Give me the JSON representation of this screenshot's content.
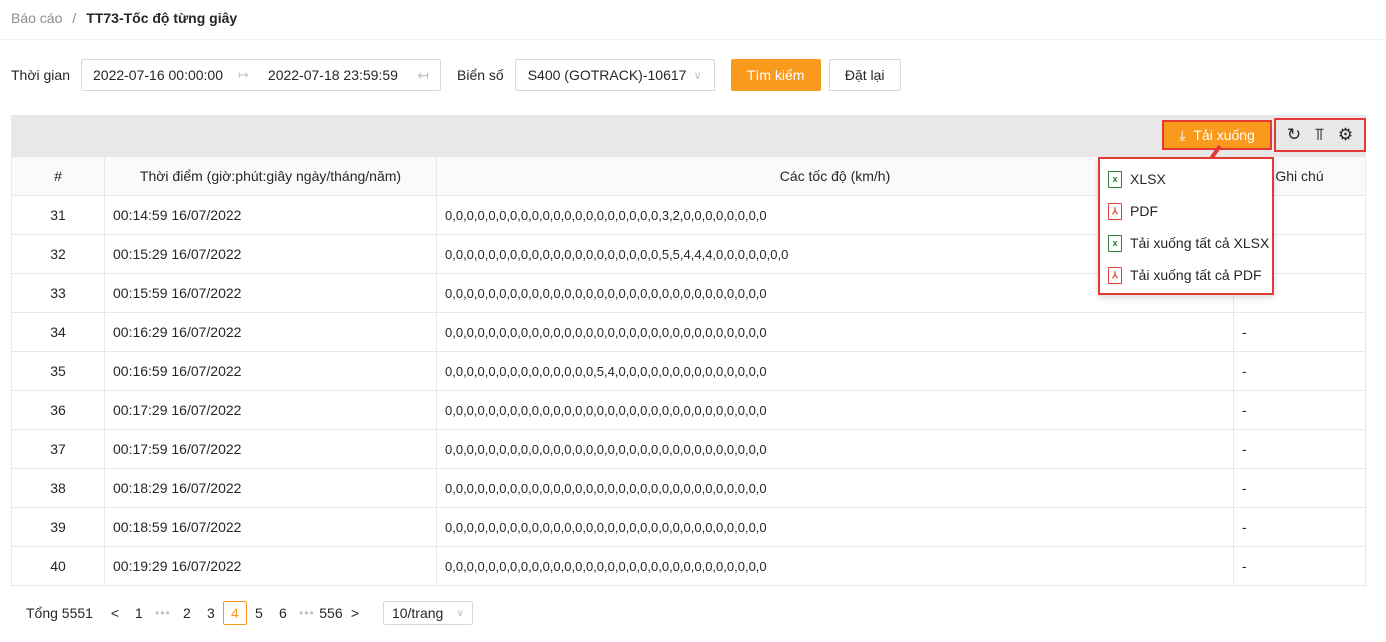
{
  "breadcrumb": {
    "parent": "Báo cáo",
    "separator": "/",
    "current": "TT73-Tốc độ từng giây"
  },
  "filters": {
    "time_label": "Thời gian",
    "start": "2022-07-16 00:00:00",
    "end": "2022-07-18 23:59:59",
    "plate_label": "Biển số",
    "plate_value": "S400 (GOTRACK)-10617",
    "search_label": "Tìm kiếm",
    "reset_label": "Đặt lại"
  },
  "toolbar": {
    "download_label": "Tải xuống"
  },
  "dropdown": {
    "items": [
      {
        "label": "XLSX",
        "type": "xlsx"
      },
      {
        "label": "PDF",
        "type": "pdf"
      },
      {
        "label": "Tải xuống tất cả XLSX",
        "type": "xlsx"
      },
      {
        "label": "Tải xuống tất cả PDF",
        "type": "pdf"
      }
    ]
  },
  "table": {
    "headers": [
      "#",
      "Thời điểm (giờ:phút:giây ngày/tháng/năm)",
      "Các tốc độ (km/h)",
      "Ghi chú"
    ],
    "rows": [
      [
        "31",
        "00:14:59 16/07/2022",
        "0,0,0,0,0,0,0,0,0,0,0,0,0,0,0,0,0,0,0,0,3,2,0,0,0,0,0,0,0,0",
        ""
      ],
      [
        "32",
        "00:15:29 16/07/2022",
        "0,0,0,0,0,0,0,0,0,0,0,0,0,0,0,0,0,0,0,0,5,5,4,4,4,0,0,0,0,0,0,0",
        ""
      ],
      [
        "33",
        "00:15:59 16/07/2022",
        "0,0,0,0,0,0,0,0,0,0,0,0,0,0,0,0,0,0,0,0,0,0,0,0,0,0,0,0,0,0",
        ""
      ],
      [
        "34",
        "00:16:29 16/07/2022",
        "0,0,0,0,0,0,0,0,0,0,0,0,0,0,0,0,0,0,0,0,0,0,0,0,0,0,0,0,0,0",
        "-"
      ],
      [
        "35",
        "00:16:59 16/07/2022",
        "0,0,0,0,0,0,0,0,0,0,0,0,0,0,5,4,0,0,0,0,0,0,0,0,0,0,0,0,0,0",
        "-"
      ],
      [
        "36",
        "00:17:29 16/07/2022",
        "0,0,0,0,0,0,0,0,0,0,0,0,0,0,0,0,0,0,0,0,0,0,0,0,0,0,0,0,0,0",
        "-"
      ],
      [
        "37",
        "00:17:59 16/07/2022",
        "0,0,0,0,0,0,0,0,0,0,0,0,0,0,0,0,0,0,0,0,0,0,0,0,0,0,0,0,0,0",
        "-"
      ],
      [
        "38",
        "00:18:29 16/07/2022",
        "0,0,0,0,0,0,0,0,0,0,0,0,0,0,0,0,0,0,0,0,0,0,0,0,0,0,0,0,0,0",
        "-"
      ],
      [
        "39",
        "00:18:59 16/07/2022",
        "0,0,0,0,0,0,0,0,0,0,0,0,0,0,0,0,0,0,0,0,0,0,0,0,0,0,0,0,0,0",
        "-"
      ],
      [
        "40",
        "00:19:29 16/07/2022",
        "0,0,0,0,0,0,0,0,0,0,0,0,0,0,0,0,0,0,0,0,0,0,0,0,0,0,0,0,0,0",
        "-"
      ]
    ]
  },
  "pagination": {
    "total_label": "Tổng 5551",
    "prev": "<",
    "next": ">",
    "pages": [
      "1",
      "•••",
      "2",
      "3",
      "4",
      "5",
      "6",
      "•••",
      "556"
    ],
    "active": "4",
    "page_size": "10/trang"
  },
  "colors": {
    "accent": "#fa9a1c",
    "highlight": "#e53935"
  }
}
